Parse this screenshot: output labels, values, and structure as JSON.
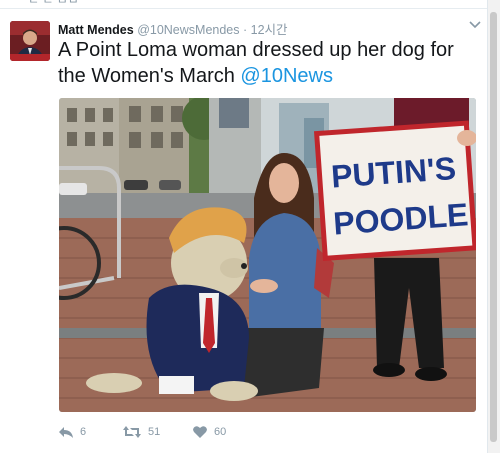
{
  "top_partial_text": "ㄴ ㄴ ㅁㅂ",
  "tweet": {
    "author_name": "Matt Mendes",
    "author_handle": "@10NewsMendes",
    "separator": "·",
    "timestamp": "12시간",
    "text_main": "A Point Loma woman dressed up her dog for the Women's March ",
    "text_mention": "@10News",
    "photo": {
      "sign_line1": "PUTIN'S",
      "sign_line2": "POODLE"
    },
    "actions": {
      "reply_count": "6",
      "retweet_count": "51",
      "like_count": "60"
    }
  },
  "colors": {
    "link": "#1b95e0",
    "muted": "#8899a6",
    "sign_red": "#c0262c",
    "sign_blue": "#1e3a8a"
  }
}
